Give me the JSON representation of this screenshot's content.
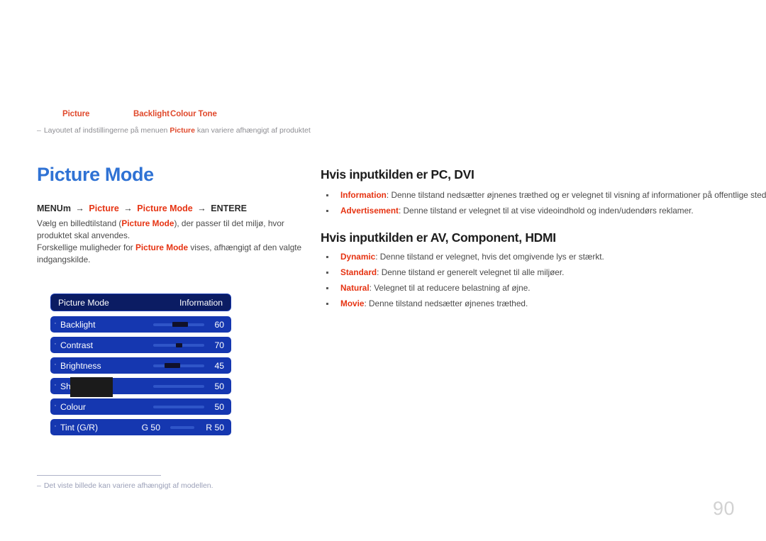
{
  "tab_strip": [
    {
      "label": "Picture"
    },
    {
      "label": "Backlight"
    },
    {
      "label": "Colour Tone"
    }
  ],
  "top_note": {
    "dash": "–",
    "before": "Layoutet af indstillingerne på menuen ",
    "bold": "Picture",
    "after": " kan variere afhængigt af produktet"
  },
  "left": {
    "title": "Picture Mode",
    "breadcrumb": {
      "menu": "MENU",
      "menu_key": "m",
      "arrow": "→",
      "crumb1": "Picture",
      "crumb2": "Picture Mode",
      "enter": "ENTER",
      "enter_key": "E"
    },
    "paragraph_1": {
      "part1": "Vælg en billedtilstand (",
      "bold": "Picture Mode",
      "part2": "), der passer til det miljø, hvor produktet skal anvendes."
    },
    "paragraph_2": {
      "part1": "Forskellige muligheder for ",
      "bold": "Picture Mode",
      "part2": " vises, afhængigt af den valgte indgangskilde."
    }
  },
  "osd": {
    "header": {
      "label": "Picture Mode",
      "value": "Information"
    },
    "rows": [
      {
        "bullet": "·",
        "label": "Backlight",
        "value": "60",
        "slider": true,
        "handle_pct": 38,
        "handle_size": "large"
      },
      {
        "bullet": "·",
        "label": "Contrast",
        "value": "70",
        "slider": true,
        "handle_pct": 45,
        "handle_size": "small"
      },
      {
        "bullet": "·",
        "label": "Brightness",
        "value": "45",
        "slider": true,
        "handle_pct": 22,
        "handle_size": "large"
      },
      {
        "bullet": "·",
        "label": "Sharpness",
        "value": "50",
        "slider": true,
        "handle_pct": -1,
        "handle_size": "none"
      },
      {
        "bullet": "·",
        "label": "Colour",
        "value": "50",
        "slider": true,
        "handle_pct": -1,
        "handle_size": "none"
      }
    ],
    "tint_row": {
      "bullet": "·",
      "label": "Tint (G/R)",
      "left_value": "G 50",
      "right_value": "R 50"
    }
  },
  "right": {
    "section_pc": {
      "heading": "Hvis inputkilden er PC, DVI",
      "items": [
        {
          "term": "Information",
          "text": ": Denne tilstand nedsætter øjnenes træthed og er velegnet til visning af informationer på offentlige steder."
        },
        {
          "term": "Advertisement",
          "text": ": Denne tilstand er velegnet til at vise videoindhold og inden/udendørs reklamer."
        }
      ]
    },
    "section_av": {
      "heading": "Hvis inputkilden er AV, Component, HDMI",
      "items": [
        {
          "term": "Dynamic",
          "text": ": Denne tilstand er velegnet, hvis det omgivende lys er stærkt."
        },
        {
          "term": "Standard",
          "text": ": Denne tilstand er generelt velegnet til alle miljøer."
        },
        {
          "term": "Natural",
          "text": ": Velegnet til at reducere belastning af øjne."
        },
        {
          "term": "Movie",
          "text": ": Denne tilstand nedsætter øjnenes træthed."
        }
      ]
    }
  },
  "footnote": {
    "dash": "–",
    "text": "Det viste billede kan variere afhængigt af modellen."
  },
  "page_number": "90",
  "colors": {
    "accent_red": "#e63312",
    "tab_red": "#e0492c",
    "title_blue": "#2f72d4",
    "osd_row_blue": "#1537b0",
    "osd_header_navy": "#0b1c63"
  }
}
